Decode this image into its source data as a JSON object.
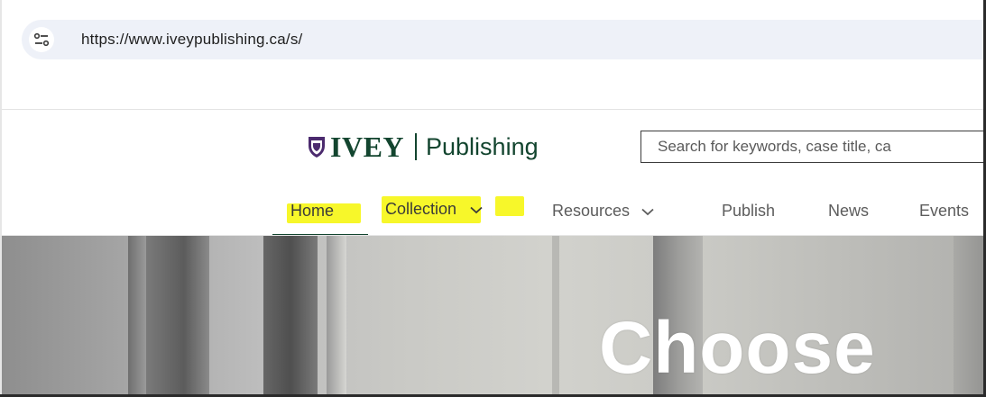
{
  "browser": {
    "url": "https://www.iveypublishing.ca/s/",
    "site_info_icon": "tune-icon"
  },
  "header": {
    "logo_wordmark": "IVEY",
    "logo_separator": "|",
    "logo_subtitle": "Publishing",
    "search_placeholder": "Search for keywords, case title, ca"
  },
  "nav": {
    "items": [
      {
        "label": "Home",
        "highlighted": true,
        "active": true
      },
      {
        "label": "Collection",
        "highlighted": true,
        "has_dropdown": true
      },
      {
        "label": "Resources",
        "has_dropdown": true
      },
      {
        "label": "Publish"
      },
      {
        "label": "News"
      },
      {
        "label": "Events"
      }
    ]
  },
  "hero": {
    "title": "Choose"
  },
  "colors": {
    "brand_green": "#13452f",
    "highlight_yellow": "#f7f72a",
    "url_bar_bg": "#eef1f8"
  }
}
